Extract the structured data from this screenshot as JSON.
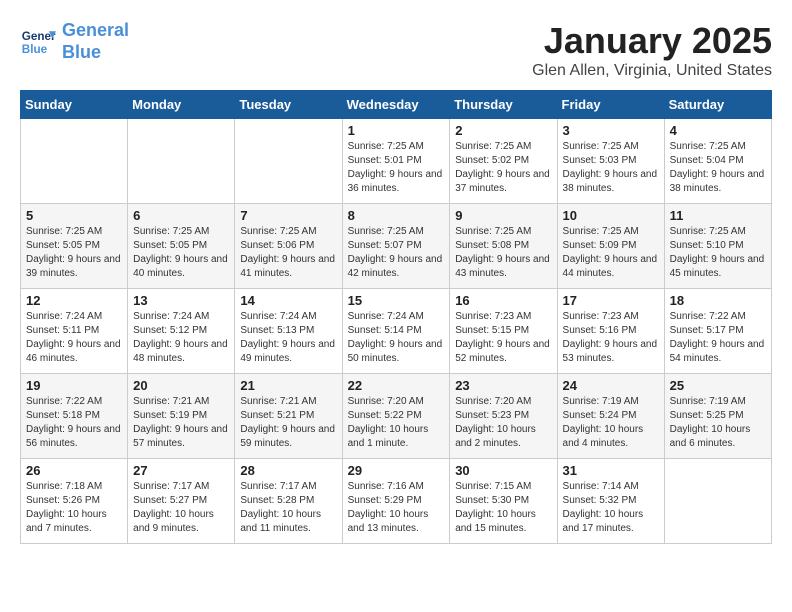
{
  "header": {
    "logo_line1": "General",
    "logo_line2": "Blue",
    "month": "January 2025",
    "location": "Glen Allen, Virginia, United States"
  },
  "columns": [
    "Sunday",
    "Monday",
    "Tuesday",
    "Wednesday",
    "Thursday",
    "Friday",
    "Saturday"
  ],
  "weeks": [
    [
      {
        "day": "",
        "info": ""
      },
      {
        "day": "",
        "info": ""
      },
      {
        "day": "",
        "info": ""
      },
      {
        "day": "1",
        "info": "Sunrise: 7:25 AM\nSunset: 5:01 PM\nDaylight: 9 hours and 36 minutes."
      },
      {
        "day": "2",
        "info": "Sunrise: 7:25 AM\nSunset: 5:02 PM\nDaylight: 9 hours and 37 minutes."
      },
      {
        "day": "3",
        "info": "Sunrise: 7:25 AM\nSunset: 5:03 PM\nDaylight: 9 hours and 38 minutes."
      },
      {
        "day": "4",
        "info": "Sunrise: 7:25 AM\nSunset: 5:04 PM\nDaylight: 9 hours and 38 minutes."
      }
    ],
    [
      {
        "day": "5",
        "info": "Sunrise: 7:25 AM\nSunset: 5:05 PM\nDaylight: 9 hours and 39 minutes."
      },
      {
        "day": "6",
        "info": "Sunrise: 7:25 AM\nSunset: 5:05 PM\nDaylight: 9 hours and 40 minutes."
      },
      {
        "day": "7",
        "info": "Sunrise: 7:25 AM\nSunset: 5:06 PM\nDaylight: 9 hours and 41 minutes."
      },
      {
        "day": "8",
        "info": "Sunrise: 7:25 AM\nSunset: 5:07 PM\nDaylight: 9 hours and 42 minutes."
      },
      {
        "day": "9",
        "info": "Sunrise: 7:25 AM\nSunset: 5:08 PM\nDaylight: 9 hours and 43 minutes."
      },
      {
        "day": "10",
        "info": "Sunrise: 7:25 AM\nSunset: 5:09 PM\nDaylight: 9 hours and 44 minutes."
      },
      {
        "day": "11",
        "info": "Sunrise: 7:25 AM\nSunset: 5:10 PM\nDaylight: 9 hours and 45 minutes."
      }
    ],
    [
      {
        "day": "12",
        "info": "Sunrise: 7:24 AM\nSunset: 5:11 PM\nDaylight: 9 hours and 46 minutes."
      },
      {
        "day": "13",
        "info": "Sunrise: 7:24 AM\nSunset: 5:12 PM\nDaylight: 9 hours and 48 minutes."
      },
      {
        "day": "14",
        "info": "Sunrise: 7:24 AM\nSunset: 5:13 PM\nDaylight: 9 hours and 49 minutes."
      },
      {
        "day": "15",
        "info": "Sunrise: 7:24 AM\nSunset: 5:14 PM\nDaylight: 9 hours and 50 minutes."
      },
      {
        "day": "16",
        "info": "Sunrise: 7:23 AM\nSunset: 5:15 PM\nDaylight: 9 hours and 52 minutes."
      },
      {
        "day": "17",
        "info": "Sunrise: 7:23 AM\nSunset: 5:16 PM\nDaylight: 9 hours and 53 minutes."
      },
      {
        "day": "18",
        "info": "Sunrise: 7:22 AM\nSunset: 5:17 PM\nDaylight: 9 hours and 54 minutes."
      }
    ],
    [
      {
        "day": "19",
        "info": "Sunrise: 7:22 AM\nSunset: 5:18 PM\nDaylight: 9 hours and 56 minutes."
      },
      {
        "day": "20",
        "info": "Sunrise: 7:21 AM\nSunset: 5:19 PM\nDaylight: 9 hours and 57 minutes."
      },
      {
        "day": "21",
        "info": "Sunrise: 7:21 AM\nSunset: 5:21 PM\nDaylight: 9 hours and 59 minutes."
      },
      {
        "day": "22",
        "info": "Sunrise: 7:20 AM\nSunset: 5:22 PM\nDaylight: 10 hours and 1 minute."
      },
      {
        "day": "23",
        "info": "Sunrise: 7:20 AM\nSunset: 5:23 PM\nDaylight: 10 hours and 2 minutes."
      },
      {
        "day": "24",
        "info": "Sunrise: 7:19 AM\nSunset: 5:24 PM\nDaylight: 10 hours and 4 minutes."
      },
      {
        "day": "25",
        "info": "Sunrise: 7:19 AM\nSunset: 5:25 PM\nDaylight: 10 hours and 6 minutes."
      }
    ],
    [
      {
        "day": "26",
        "info": "Sunrise: 7:18 AM\nSunset: 5:26 PM\nDaylight: 10 hours and 7 minutes."
      },
      {
        "day": "27",
        "info": "Sunrise: 7:17 AM\nSunset: 5:27 PM\nDaylight: 10 hours and 9 minutes."
      },
      {
        "day": "28",
        "info": "Sunrise: 7:17 AM\nSunset: 5:28 PM\nDaylight: 10 hours and 11 minutes."
      },
      {
        "day": "29",
        "info": "Sunrise: 7:16 AM\nSunset: 5:29 PM\nDaylight: 10 hours and 13 minutes."
      },
      {
        "day": "30",
        "info": "Sunrise: 7:15 AM\nSunset: 5:30 PM\nDaylight: 10 hours and 15 minutes."
      },
      {
        "day": "31",
        "info": "Sunrise: 7:14 AM\nSunset: 5:32 PM\nDaylight: 10 hours and 17 minutes."
      },
      {
        "day": "",
        "info": ""
      }
    ]
  ]
}
